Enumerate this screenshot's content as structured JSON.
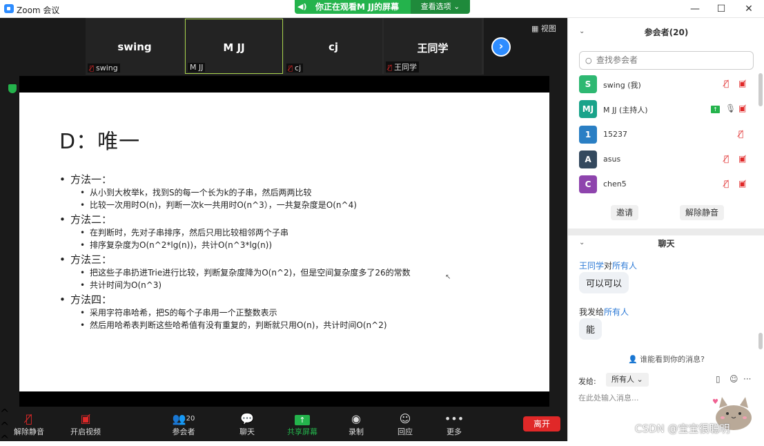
{
  "window": {
    "title": "Zoom 会议",
    "minimize": "—",
    "maximize": "☐",
    "close": "✕"
  },
  "banner": {
    "text": "你正在观看M JJ的屏幕",
    "view_options": "查看选项 ⌄"
  },
  "video_strip": {
    "view_label": "视图",
    "tiles": [
      {
        "name": "swing",
        "label": "swing",
        "muted": true,
        "active": false
      },
      {
        "name": "M JJ",
        "label": "M JJ",
        "muted": false,
        "active": true
      },
      {
        "name": "cj",
        "label": "cj",
        "muted": true,
        "active": false
      },
      {
        "name": "王同学",
        "label": "王同学",
        "muted": true,
        "active": false
      }
    ]
  },
  "slide": {
    "title": "D：唯一",
    "methods": [
      {
        "head": "方法一：",
        "items": [
          "从小到大枚举k，找到S的每一个长为k的子串，然后两两比较",
          "比较一次用时O(n)，判断一次k一共用时O(n^3），一共复杂度是O(n^4)"
        ]
      },
      {
        "head": "方法二：",
        "items": [
          "在判断时，先对子串排序，然后只用比较相邻两个子串",
          "排序复杂度为O(n^2*lg(n))，共计O(n^3*lg(n))"
        ]
      },
      {
        "head": "方法三：",
        "items": [
          "把这些子串扔进Trie进行比较，判断复杂度降为O(n^2)，但是空间复杂度多了26的常数",
          "共计时间为O(n^3)"
        ]
      },
      {
        "head": "方法四：",
        "items": [
          "采用字符串哈希，把S的每个子串用一个正整数表示",
          "然后用哈希表判断这些哈希值有没有重复的，判断就只用O(n)，共计时间O(n^2)"
        ]
      }
    ]
  },
  "toolbar": {
    "unmute": "解除静音",
    "start_video": "开启视频",
    "participants": "参会者",
    "participants_count": "20",
    "chat": "聊天",
    "share": "共享屏幕",
    "record": "录制",
    "reactions": "回应",
    "more": "更多",
    "leave": "离开"
  },
  "participants_panel": {
    "title": "参会者(20)",
    "search_placeholder": "查找参会者",
    "list": [
      {
        "initials": "S",
        "name": "swing (我)",
        "color": "#2eb872"
      },
      {
        "initials": "MJ",
        "name": "M JJ (主持人)",
        "color": "#19a38a"
      },
      {
        "initials": "1",
        "name": "15237",
        "color": "#2a7fc4"
      },
      {
        "initials": "A",
        "name": "asus",
        "color": "#34495e"
      },
      {
        "initials": "C",
        "name": "chen5",
        "color": "#8e44ad"
      }
    ],
    "invite": "邀请",
    "unmute_me": "解除静音"
  },
  "chat_panel": {
    "title": "聊天",
    "messages": [
      {
        "from": "王同学",
        "to_prefix": "对",
        "to": "所有人",
        "text": "可以可以"
      },
      {
        "from": "我发给",
        "to_prefix": "",
        "to": "所有人",
        "text": "能"
      }
    ],
    "who_can_see": "谁能看到你的消息?",
    "send_to_label": "发给:",
    "send_to_value": "所有人 ⌄",
    "input_placeholder": "在此处输入消息..."
  },
  "watermark": "CSDN @宝宝很聪明"
}
